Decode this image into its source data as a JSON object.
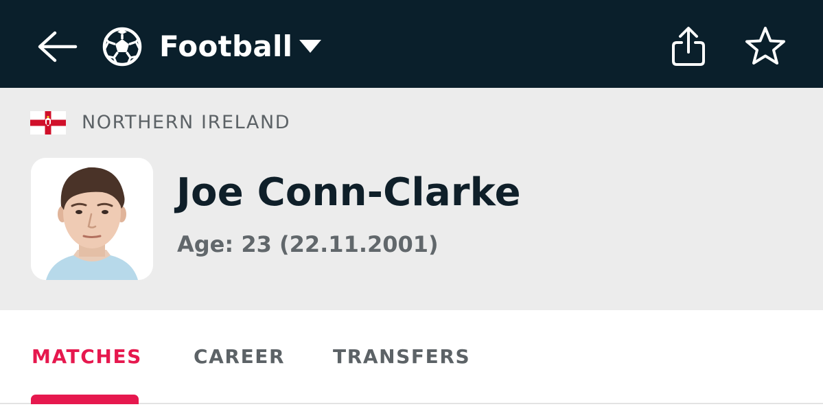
{
  "header": {
    "sport_title": "Football",
    "back_icon": "arrow-left-icon",
    "sport_icon": "soccer-ball-icon",
    "dropdown_icon": "caret-down-icon",
    "share_icon": "share-icon",
    "favorite_icon": "star-icon"
  },
  "player": {
    "country": "NORTHERN IRELAND",
    "name": "Joe Conn-Clarke",
    "age_text": "Age: 23 (22.11.2001)"
  },
  "tabs": [
    {
      "label": "MATCHES",
      "active": true
    },
    {
      "label": "CAREER",
      "active": false
    },
    {
      "label": "TRANSFERS",
      "active": false
    }
  ],
  "colors": {
    "header_bg": "#0a1f2b",
    "profile_bg": "#ececec",
    "accent": "#e6184e",
    "name_text": "#0f1f29",
    "muted_text": "#5c6266"
  }
}
